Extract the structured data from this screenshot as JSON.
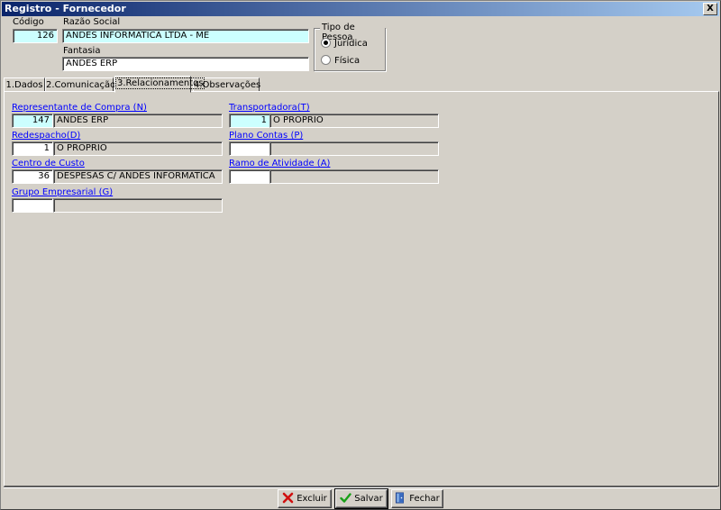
{
  "window": {
    "title": "Registro - Fornecedor",
    "close_label": "X"
  },
  "header": {
    "codigo_label": "Código",
    "codigo_value": "126",
    "razao_label": "Razão Social",
    "razao_value": "ANDES INFORMATICA LTDA - ME",
    "fantasia_label": "Fantasia",
    "fantasia_value": "ANDES ERP",
    "tipo_pessoa": {
      "title": "Tipo de Pessoa",
      "options": [
        "Jurídica",
        "Física"
      ],
      "selected": "Jurídica"
    }
  },
  "tabs": [
    "1.Dados",
    "2.Comunicação",
    "3.Relacionamentos",
    "4.Observações"
  ],
  "active_tab": "3.Relacionamentos",
  "relacionamentos": {
    "representante": {
      "label": "Representante de Compra (N)",
      "code": "147",
      "desc": "ANDES ERP"
    },
    "transportadora": {
      "label": "Transportadora(T)",
      "code": "1",
      "desc": "O PROPRIO"
    },
    "redespacho": {
      "label": "Redespacho(D)",
      "code": "1",
      "desc": "O PROPRIO"
    },
    "plano_contas": {
      "label": "Plano Contas (P)",
      "code": "",
      "desc": ""
    },
    "centro_custo": {
      "label": "Centro de Custo",
      "code": "36",
      "desc": "DESPESAS C/ ANDES INFORMATICA"
    },
    "ramo_atividade": {
      "label": "Ramo de Atividade (A)",
      "code": "",
      "desc": ""
    },
    "grupo_empresarial": {
      "label": "Grupo Empresarial (G)",
      "code": "",
      "desc": ""
    }
  },
  "buttons": {
    "excluir": "Excluir",
    "salvar": "Salvar",
    "fechar": "Fechar"
  },
  "icons": {
    "excluir": "x-red-icon",
    "salvar": "check-green-icon",
    "fechar": "door-exit-icon"
  }
}
